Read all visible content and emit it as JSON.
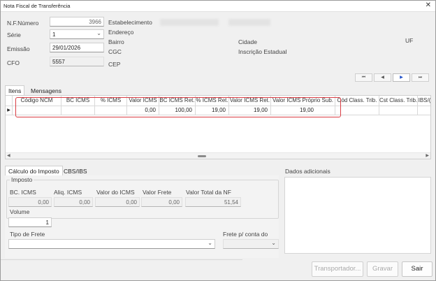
{
  "window": {
    "title": "Nota Fiscal de Transferência",
    "close_icon": "close-icon"
  },
  "header": {
    "nf_numero": {
      "label": "N.F.Número",
      "value": "3966"
    },
    "serie": {
      "label": "Série",
      "value": "1"
    },
    "emissao": {
      "label": "Emissão",
      "value": "29/01/2026"
    },
    "cfo": {
      "label": "CFO",
      "value": "5557"
    },
    "estabelecimento_label": "Estabelecimento",
    "endereco_label": "Endereço",
    "bairro_label": "Bairro",
    "cgc_label": "CGC",
    "cep_label": "CEP",
    "cidade_label": "Cidade",
    "inscricao_label": "Inscrição Estadual",
    "uf_label": "UF"
  },
  "nav": {
    "first": "⏮",
    "prev": "◀",
    "next": "▶",
    "last": "⏭"
  },
  "tabs_top": [
    {
      "label": "Itens",
      "selected": true
    },
    {
      "label": "Mensagens",
      "selected": false
    }
  ],
  "grid": {
    "columns": [
      "Código NCM",
      "BC ICMS",
      "% ICMS",
      "Valor ICMS",
      "BC ICMS Ret.",
      "% ICMS Ret.",
      "Valor ICMS Ret.",
      "Valor ICMS Próprio Sub.",
      "Cód Class. Trib.",
      "Cst Class. Trib.",
      "IBS/("
    ],
    "row": [
      "",
      "",
      "",
      "0,00",
      "100,00",
      "19,00",
      "19,00",
      "19,00",
      "",
      "",
      ""
    ]
  },
  "tabs_bottom": [
    {
      "label": "Cálculo do Imposto",
      "selected": true
    },
    {
      "label": "CBS/IBS",
      "selected": false
    }
  ],
  "imposto": {
    "group_label": "Imposto",
    "bc_icms": {
      "label": "BC. ICMS",
      "value": "0,00"
    },
    "aliq_icms": {
      "label": "Aliq. ICMS",
      "value": "0,00"
    },
    "valor_icms": {
      "label": "Valor do ICMS",
      "value": "0,00"
    },
    "valor_frete": {
      "label": "Valor Frete",
      "value": "0,00"
    },
    "valor_total": {
      "label": "Valor Total da NF",
      "value": "51,54"
    }
  },
  "volume": {
    "label": "Volume",
    "value": "1"
  },
  "tipo_frete": {
    "label": "Tipo de Frete",
    "value": ""
  },
  "frete_conta": {
    "label": "Frete p/ conta do",
    "value": ""
  },
  "dados_adicionais": {
    "label": "Dados adicionais",
    "value": ""
  },
  "buttons": {
    "transportador": "Transportador...",
    "gravar": "Gravar",
    "sair": "Sair"
  }
}
